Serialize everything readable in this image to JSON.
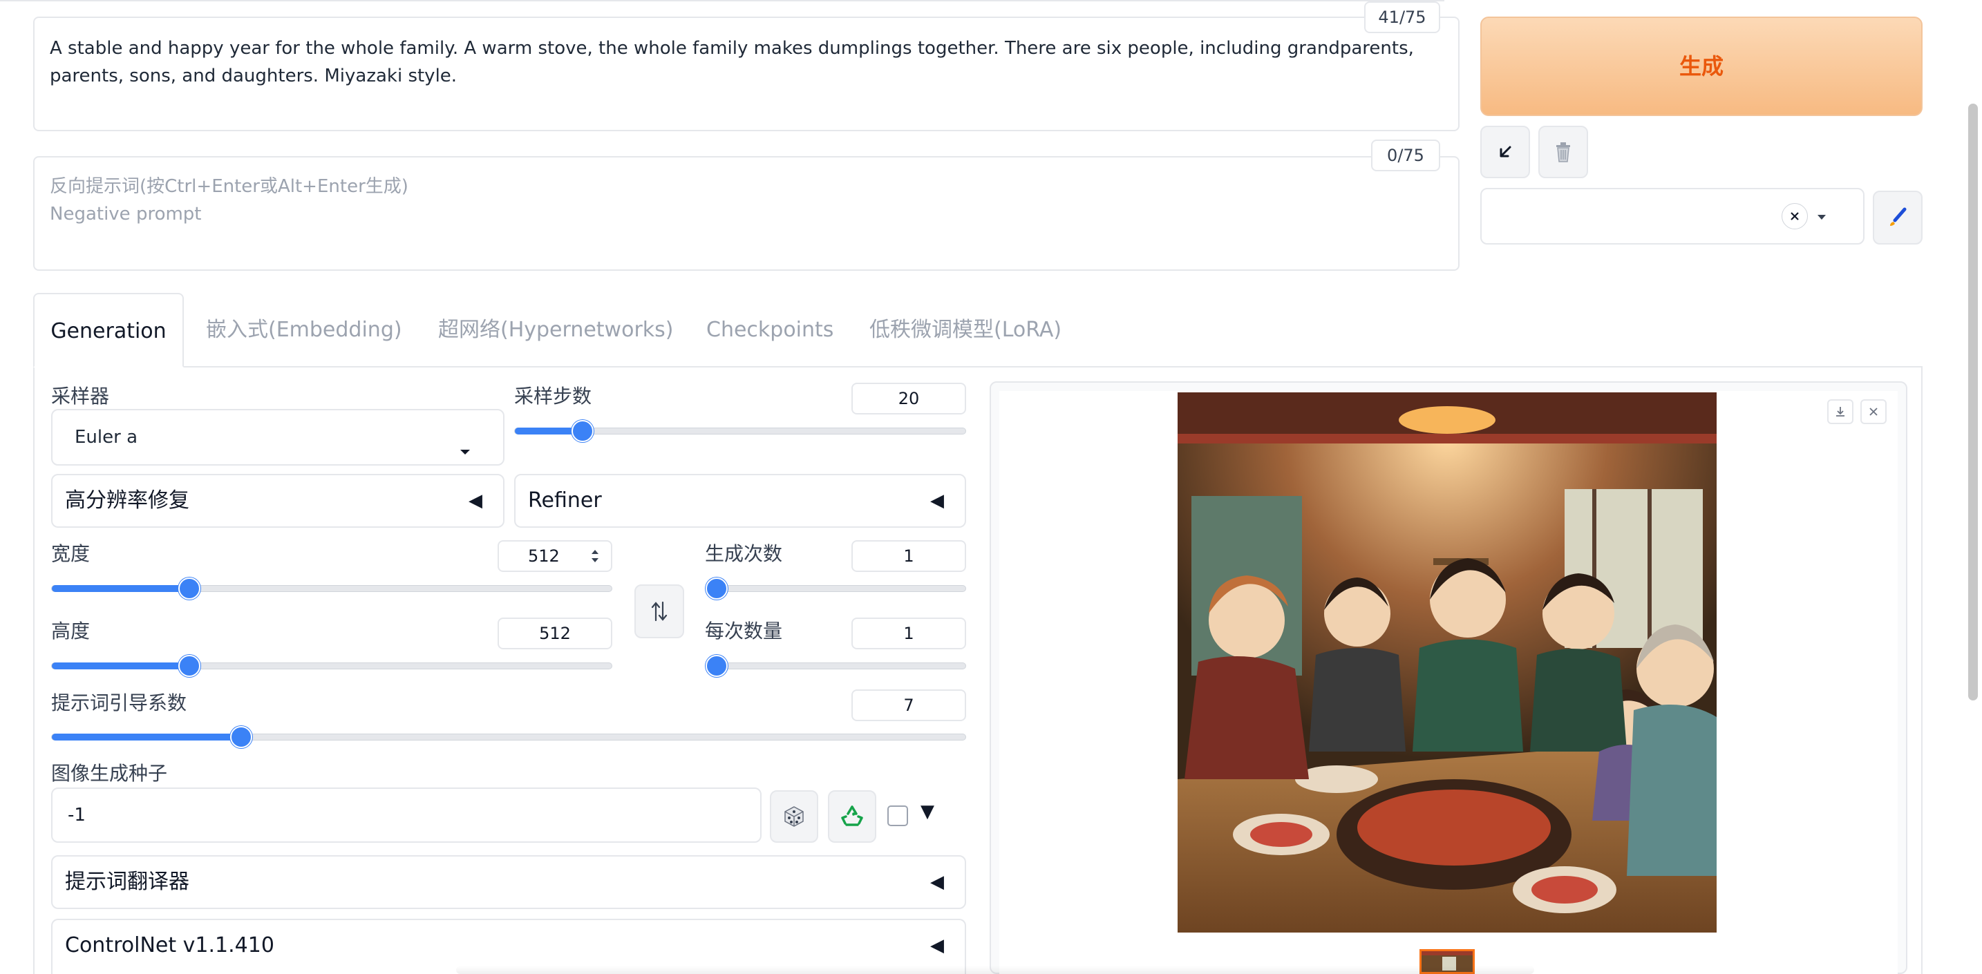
{
  "prompt": {
    "text": "A stable and happy year for the whole family. A warm stove, the whole family makes dumplings together. There are six people, including grandparents, parents, sons, and daughters. Miyazaki style.",
    "counter": "41/75"
  },
  "negative_prompt": {
    "placeholder_line1": "反向提示词(按Ctrl+Enter或Alt+Enter生成)",
    "placeholder_line2": "Negative prompt",
    "counter": "0/75"
  },
  "actions": {
    "generate_label": "生成",
    "read_params_icon": "arrow-down-left-icon",
    "trash_icon": "trash-icon",
    "clear_icon": "close-icon",
    "edit_styles_icon": "paint-brush-icon"
  },
  "tabs": [
    {
      "label": "Generation",
      "active": true
    },
    {
      "label": "嵌入式(Embedding)",
      "active": false
    },
    {
      "label": "超网络(Hypernetworks)",
      "active": false
    },
    {
      "label": "Checkpoints",
      "active": false
    },
    {
      "label": "低秩微调模型(LoRA)",
      "active": false
    }
  ],
  "generation": {
    "sampler_label": "采样器",
    "sampler_value": "Euler a",
    "steps_label": "采样步数",
    "steps_value": "20",
    "steps_fraction": 0.133,
    "hires_label": "高分辨率修复",
    "refiner_label": "Refiner",
    "width_label": "宽度",
    "width_value": "512",
    "width_fraction": 0.235,
    "height_label": "高度",
    "height_value": "512",
    "height_fraction": 0.235,
    "batch_count_label": "生成次数",
    "batch_count_value": "1",
    "batch_count_fraction": 0.0,
    "batch_size_label": "每次数量",
    "batch_size_value": "1",
    "batch_size_fraction": 0.0,
    "cfg_label": "提示词引导系数",
    "cfg_value": "7",
    "cfg_fraction": 0.2,
    "seed_label": "图像生成种子",
    "seed_value": "-1",
    "translator_label": "提示词翻译器",
    "controlnet_label": "ControlNet v1.1.410"
  },
  "colors": {
    "accent": "#3b82f6",
    "generate_text": "#ea580c",
    "border": "#e5e7eb"
  }
}
